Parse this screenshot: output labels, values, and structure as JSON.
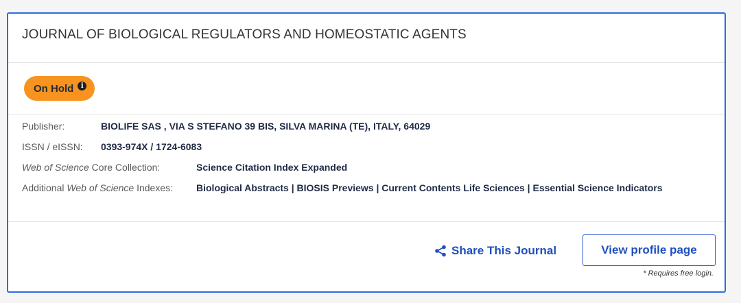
{
  "journal": {
    "title": "JOURNAL OF BIOLOGICAL REGULATORS AND HOMEOSTATIC AGENTS"
  },
  "status": {
    "label": "On Hold",
    "info_icon": "info-icon",
    "badge_color": "#f7931e"
  },
  "details": {
    "publisher_label": "Publisher:",
    "publisher_value": "BIOLIFE SAS , VIA S STEFANO 39 BIS, SILVA MARINA (TE), ITALY, 64029",
    "issn_label": "ISSN / eISSN:",
    "issn_value": "0393-974X / 1724-6083",
    "core_label_italic": "Web of Science",
    "core_label_rest": " Core Collection:",
    "core_value": "Science Citation Index Expanded",
    "additional_label_pre": "Additional ",
    "additional_label_italic": "Web of Science",
    "additional_label_post": " Indexes:",
    "additional_value": "Biological Abstracts | BIOSIS Previews | Current Contents Life Sciences | Essential Science Indicators"
  },
  "footer": {
    "share_label": "Share This Journal",
    "share_icon": "share-icon",
    "profile_button_label": "View profile page",
    "login_note": "* Requires free login."
  },
  "colors": {
    "accent": "#2d6bdc",
    "link": "#1e4fbd",
    "value_text": "#1f2a44"
  }
}
